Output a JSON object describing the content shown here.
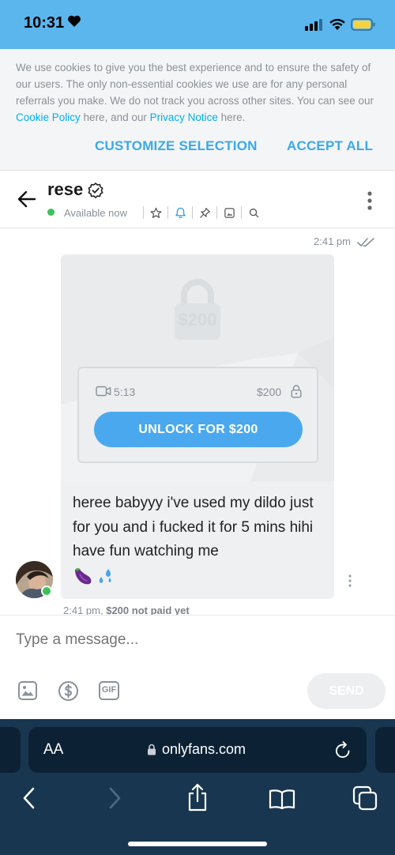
{
  "status_bar": {
    "time": "10:31"
  },
  "cookie_banner": {
    "text_before": "We use cookies to give you the best experience and to ensure the safety of our users. The only non-essential cookies we use are for any personal referrals you make. We do not track you across other sites. You can see our ",
    "cookie_policy_link": "Cookie Policy",
    "text_middle": " here, and our ",
    "privacy_link": "Privacy Notice",
    "text_after": " here.",
    "customize_label": "CUSTOMIZE SELECTION",
    "accept_label": "ACCEPT ALL"
  },
  "chat_header": {
    "name": "rese",
    "status": "Available now",
    "icons": [
      "star-icon",
      "bell-icon",
      "pin-icon",
      "image-icon",
      "search-icon"
    ]
  },
  "message": {
    "time": "2:41 pm",
    "locked_price_overlay": "$200",
    "video_duration": "5:13",
    "price": "$200",
    "unlock_label": "UNLOCK FOR $200",
    "text": "heree babyyy i've used my dildo just for you and i fucked it for 5 mins hihi have fun watching me",
    "emojis": [
      "eggplant",
      "sweat-droplets"
    ],
    "footer_time": "2:41 pm,",
    "footer_status": "$200 not paid yet"
  },
  "composer": {
    "placeholder": "Type a message...",
    "send_label": "SEND",
    "gif_label": "GIF"
  },
  "browser": {
    "aa_label": "AA",
    "url": "onlyfans.com"
  },
  "colors": {
    "accent": "#00aff0",
    "button_blue": "#4aa9ee",
    "status_bar": "#5bb6ee",
    "online_green": "#3cc15a",
    "browser_bg": "#18364f"
  }
}
